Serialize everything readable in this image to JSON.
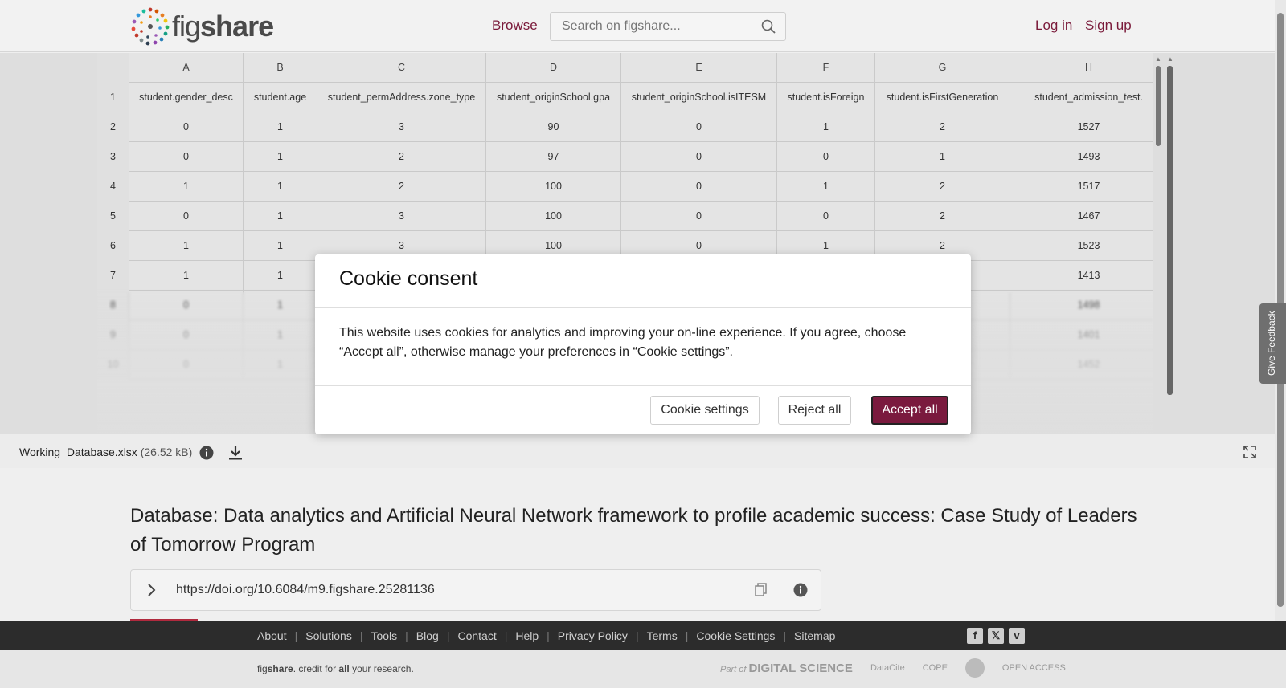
{
  "header": {
    "brand_prefix": "fig",
    "brand_suffix": "share",
    "browse": "Browse",
    "search_placeholder": "Search on figshare...",
    "login": "Log in",
    "signup": "Sign up"
  },
  "sheet": {
    "columns": [
      "A",
      "B",
      "C",
      "D",
      "E",
      "F",
      "G",
      "H"
    ],
    "rows": [
      {
        "num": "1",
        "cells": [
          "student.gender_desc",
          "student.age",
          "student_permAddress.zone_type",
          "student_originSchool.gpa",
          "student_originSchool.isITESM",
          "student.isForeign",
          "student.isFirstGeneration",
          "student_admission_test."
        ]
      },
      {
        "num": "2",
        "cells": [
          "0",
          "1",
          "3",
          "90",
          "0",
          "1",
          "2",
          "1527"
        ]
      },
      {
        "num": "3",
        "cells": [
          "0",
          "1",
          "2",
          "97",
          "0",
          "0",
          "1",
          "1493"
        ]
      },
      {
        "num": "4",
        "cells": [
          "1",
          "1",
          "2",
          "100",
          "0",
          "1",
          "2",
          "1517"
        ]
      },
      {
        "num": "5",
        "cells": [
          "0",
          "1",
          "3",
          "100",
          "0",
          "0",
          "2",
          "1467"
        ]
      },
      {
        "num": "6",
        "cells": [
          "1",
          "1",
          "3",
          "100",
          "0",
          "1",
          "2",
          "1523"
        ]
      },
      {
        "num": "7",
        "cells": [
          "1",
          "1",
          "",
          "",
          "",
          "",
          "",
          "1413"
        ]
      },
      {
        "num": "8",
        "cells": [
          "0",
          "1",
          "",
          "",
          "",
          "",
          "",
          "1498"
        ]
      },
      {
        "num": "9",
        "cells": [
          "0",
          "1",
          "",
          "",
          "",
          "",
          "",
          "1401"
        ]
      },
      {
        "num": "10",
        "cells": [
          "0",
          "1",
          "",
          "",
          "",
          "",
          "",
          "1452"
        ]
      }
    ]
  },
  "file": {
    "name": "Working_Database.xlsx",
    "size": "(26.52 kB)"
  },
  "item": {
    "title": "Database: Data analytics and Artificial Neural Network framework to profile academic success: Case Study of Leaders of Tomorrow Program",
    "doi": "https://doi.org/10.6084/m9.figshare.25281136"
  },
  "feedback": "Give Feedback",
  "cookie": {
    "title": "Cookie consent",
    "body": "This website uses cookies for analytics and improving your on-line experience. If you agree, choose “Accept all”, otherwise manage your preferences in “Cookie settings”.",
    "settings": "Cookie settings",
    "reject": "Reject all",
    "accept": "Accept all"
  },
  "footer": {
    "links": [
      "About",
      "Solutions",
      "Tools",
      "Blog",
      "Contact",
      "Help",
      "Privacy Policy",
      "Terms",
      "Cookie Settings",
      "Sitemap"
    ],
    "tagline_a": "fig",
    "tagline_b": "share",
    "tagline_c": ". credit for ",
    "tagline_d": "all",
    "tagline_e": " your research.",
    "partner_prefix": "Part of",
    "partner_ds": "DIGITAL SCIENCE",
    "partner_datacite": "DataCite",
    "partner_cope": "COPE",
    "partner_oa": "OPEN ACCESS"
  },
  "colors": {
    "accent": "#7a1a3e",
    "footer_dark": "#2c2c2c"
  }
}
